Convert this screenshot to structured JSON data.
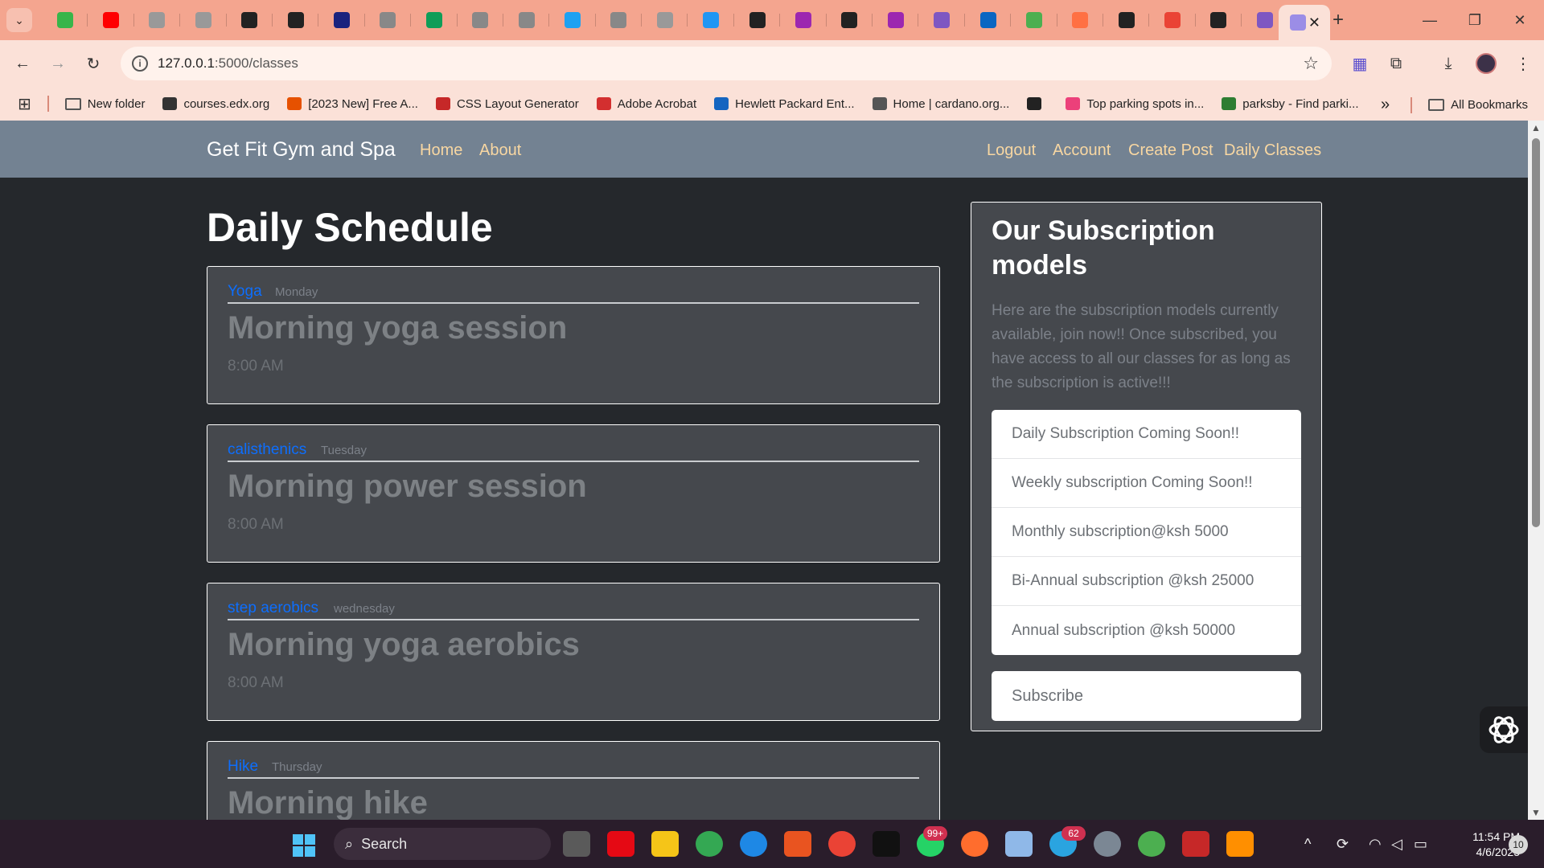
{
  "browser": {
    "url_host": "127.0.0.1",
    "url_path": ":5000/classes",
    "tab_colors": [
      "#38b54a",
      "#ff0000",
      "#999999",
      "#999999",
      "#222222",
      "#222222",
      "#1a237e",
      "#888888",
      "#0f9d58",
      "#888888",
      "#888888",
      "#1da1f2",
      "#888888",
      "#999999",
      "#2196f3",
      "#222222",
      "#9c27b0",
      "#222222",
      "#9c27b0",
      "#7e57c2",
      "#0a66c2",
      "#4caf50",
      "#ff7043",
      "#222222",
      "#ea4335",
      "#222222",
      "#7e57c2"
    ],
    "active_tab_close": "✕",
    "new_tab": "+",
    "bookmarks": [
      {
        "label": "New folder",
        "icon": "folder-icon",
        "color": "#555555"
      },
      {
        "label": "courses.edx.org",
        "icon": "edx-icon",
        "color": "#333333"
      },
      {
        "label": "[2023 New] Free A...",
        "icon": "w-icon",
        "color": "#e65100"
      },
      {
        "label": "CSS Layout Generator",
        "icon": "grid-icon",
        "color": "#c62828"
      },
      {
        "label": "Adobe Acrobat",
        "icon": "acrobat-icon",
        "color": "#d32f2f"
      },
      {
        "label": "Hewlett Packard Ent...",
        "icon": "hpe-icon",
        "color": "#1565c0"
      },
      {
        "label": "Home | cardano.org...",
        "icon": "cardano-icon",
        "color": "#555555"
      },
      {
        "label": "",
        "icon": "globe-icon",
        "color": "#222222"
      },
      {
        "label": "Top parking spots in...",
        "icon": "parking-icon",
        "color": "#ec407a"
      },
      {
        "label": "parksby - Find parki...",
        "icon": "parksby-icon",
        "color": "#2e7d32"
      }
    ],
    "bookmarks_more": "»",
    "all_bookmarks": "All Bookmarks"
  },
  "page": {
    "brand": "Get Fit Gym and Spa",
    "nav_left": [
      "Home",
      "About"
    ],
    "nav_right": [
      "Logout",
      "Account",
      "Create Post",
      "Daily Classes"
    ],
    "heading": "Daily Schedule",
    "classes": [
      {
        "category": "Yoga",
        "day": "Monday",
        "title": "Morning yoga session",
        "time": "8:00 AM"
      },
      {
        "category": "calisthenics",
        "day": "Tuesday",
        "title": "Morning power session",
        "time": "8:00 AM"
      },
      {
        "category": "step aerobics",
        "day": "wednesday",
        "title": "Morning yoga aerobics",
        "time": "8:00 AM"
      },
      {
        "category": "Hike",
        "day": "Thursday",
        "title": "Morning hike",
        "time": ""
      }
    ],
    "sidebar": {
      "title": "Our Subscription models",
      "description": "Here are the subscription models currently available, join now!! Once subscribed, you have access to all our classes for as long as the subscription is active!!!",
      "items": [
        "Daily Subscription Coming Soon!!",
        "Weekly subscription Coming Soon!!",
        "Monthly subscription@ksh 5000",
        "Bi-Annual subscription @ksh 25000",
        "Annual subscription @ksh 50000"
      ],
      "subscribe": "Subscribe"
    }
  },
  "taskbar": {
    "search_label": "Search",
    "whatsapp_badge": "99+",
    "telegram_badge": "62",
    "time": "11:54 PM",
    "date": "4/6/2025",
    "notifications": "10"
  }
}
